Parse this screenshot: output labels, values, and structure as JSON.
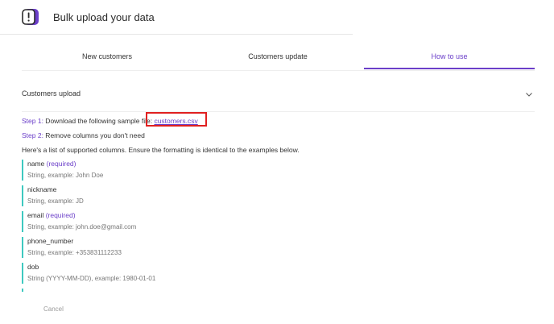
{
  "header": {
    "title": "Bulk upload your data",
    "logo_icon": "alert-box-icon",
    "accent": "#6b3fc9"
  },
  "tabs": [
    {
      "label": "New customers",
      "active": false
    },
    {
      "label": "Customers update",
      "active": false
    },
    {
      "label": "How to use",
      "active": true
    }
  ],
  "section": {
    "title": "Customers upload",
    "toggle_icon": "chevron-down-icon"
  },
  "steps": {
    "step1_label": "Step 1:",
    "step1_text": " Download the following sample file: ",
    "step1_link": "customers.csv",
    "step2_label": "Step 2:",
    "step2_text": " Remove columns you don't need"
  },
  "intro": "Here's a list of supported columns. Ensure the formatting is identical to the examples below.",
  "columns": [
    {
      "name": "name",
      "required": "(required)",
      "desc": "String, example: John Doe"
    },
    {
      "name": "nickname",
      "required": "",
      "desc": "String, example: JD"
    },
    {
      "name": "email",
      "required": "(required)",
      "desc": "String, example: john.doe@gmail.com"
    },
    {
      "name": "phone_number",
      "required": "",
      "desc": "String, example: +353831112233"
    },
    {
      "name": "dob",
      "required": "",
      "desc": "String (YYYY-MM-DD), example: 1980-01-01"
    }
  ],
  "footer": {
    "cancel_label": "Cancel"
  },
  "colors": {
    "accent": "#6b3fc9",
    "column_bar": "#3ec9c0",
    "highlight_border": "#e02020"
  }
}
